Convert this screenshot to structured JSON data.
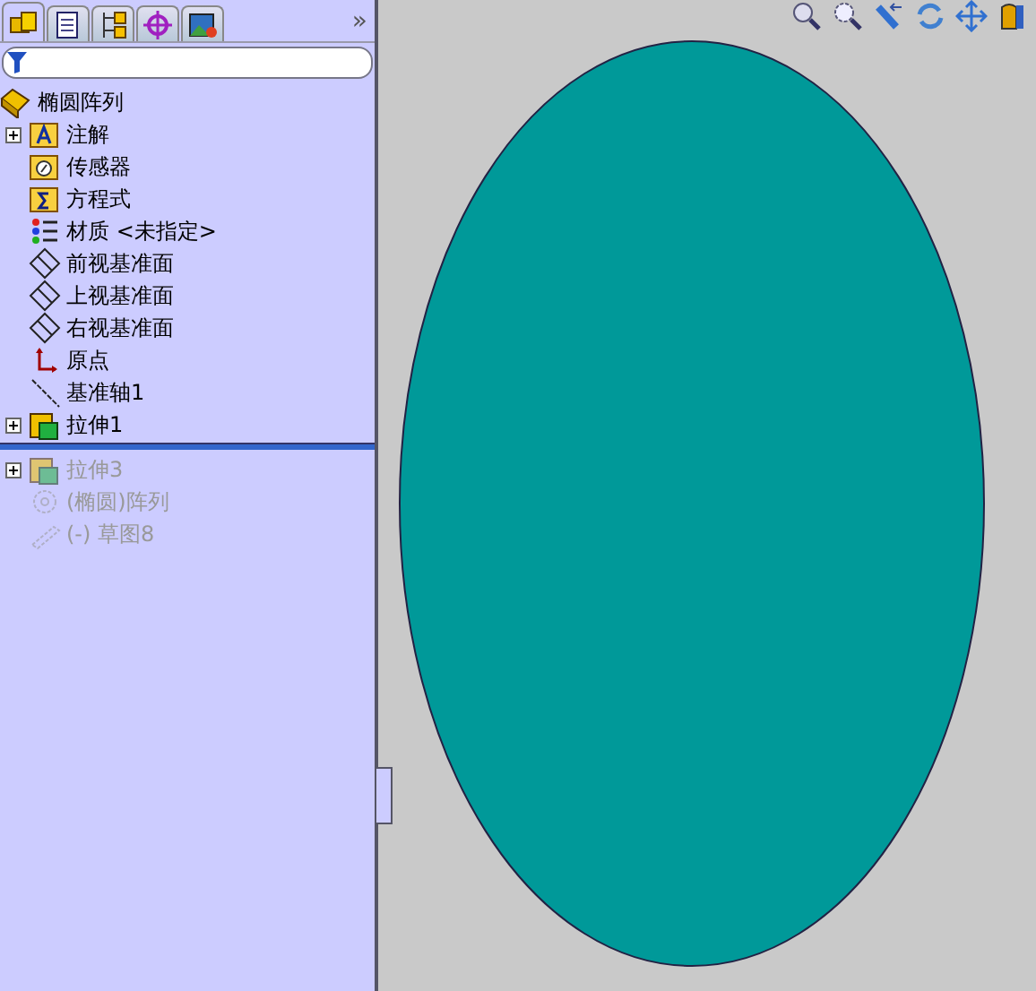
{
  "tabs": [
    {
      "kind": "feature",
      "selected": true
    },
    {
      "kind": "property",
      "selected": false
    },
    {
      "kind": "config",
      "selected": false
    },
    {
      "kind": "dimxpert",
      "selected": false
    },
    {
      "kind": "display",
      "selected": false
    }
  ],
  "more_tabs": "»",
  "filter": {
    "kind": "filter"
  },
  "tree": {
    "root": {
      "label": "椭圆阵列",
      "kind": "part"
    },
    "items": [
      {
        "label": "注解",
        "kind": "annotation",
        "expandable": true,
        "rolled_back": false
      },
      {
        "label": "传感器",
        "kind": "sensor",
        "expandable": false,
        "rolled_back": false
      },
      {
        "label": "方程式",
        "kind": "equation",
        "expandable": false,
        "rolled_back": false
      },
      {
        "label": "材质 <未指定>",
        "kind": "material",
        "expandable": false,
        "rolled_back": false
      },
      {
        "label": "前视基准面",
        "kind": "plane",
        "expandable": false,
        "rolled_back": false
      },
      {
        "label": "上视基准面",
        "kind": "plane",
        "expandable": false,
        "rolled_back": false
      },
      {
        "label": "右视基准面",
        "kind": "plane",
        "expandable": false,
        "rolled_back": false
      },
      {
        "label": "原点",
        "kind": "origin",
        "expandable": false,
        "rolled_back": false
      },
      {
        "label": "基准轴1",
        "kind": "axis",
        "expandable": false,
        "rolled_back": false
      },
      {
        "label": "拉伸1",
        "kind": "extrude",
        "expandable": true,
        "rolled_back": false
      },
      {
        "label": "拉伸3",
        "kind": "extrude",
        "expandable": true,
        "rolled_back": true
      },
      {
        "label": "(椭圆)阵列",
        "kind": "pattern",
        "expandable": false,
        "rolled_back": true
      },
      {
        "label": "(-) 草图8",
        "kind": "sketch",
        "expandable": false,
        "rolled_back": true
      }
    ]
  },
  "view_tools": [
    {
      "kind": "zoom-fit"
    },
    {
      "kind": "zoom-area"
    },
    {
      "kind": "previous-view"
    },
    {
      "kind": "rotate"
    },
    {
      "kind": "pan"
    },
    {
      "kind": "section"
    }
  ],
  "model": {
    "color": "#009999"
  }
}
